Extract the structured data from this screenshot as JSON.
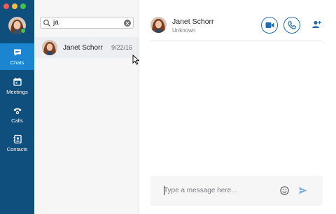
{
  "window": {
    "traffic_lights": [
      "close",
      "minimize",
      "maximize"
    ]
  },
  "rail": {
    "self_status": "online",
    "items": [
      {
        "label": "Chats",
        "icon": "chat-bubble-icon",
        "active": true
      },
      {
        "label": "Meetings",
        "icon": "calendar-icon",
        "active": false
      },
      {
        "label": "Calls",
        "icon": "phone-icon",
        "active": false
      },
      {
        "label": "Contacts",
        "icon": "contact-card-icon",
        "active": false
      }
    ]
  },
  "search": {
    "value": "ja",
    "icon": "search-icon",
    "clear_icon": "clear-icon"
  },
  "results": [
    {
      "name": "Janet Schorr",
      "date": "9/22/16"
    }
  ],
  "conversation": {
    "contact_name": "Janet Schorr",
    "contact_status": "Unknown",
    "actions": [
      "video-call-icon",
      "audio-call-icon",
      "add-person-icon"
    ]
  },
  "composer": {
    "placeholder": "Type a message here...",
    "value": "",
    "emoji_icon": "emoji-icon",
    "send_icon": "send-icon"
  },
  "colors": {
    "rail_background": "#0f4f7d",
    "rail_active": "#1c85d1",
    "accent": "#1f6db0",
    "presence_online": "#4fc14a",
    "list_background": "#f6f6f7",
    "selected_row": "#eceef1"
  }
}
